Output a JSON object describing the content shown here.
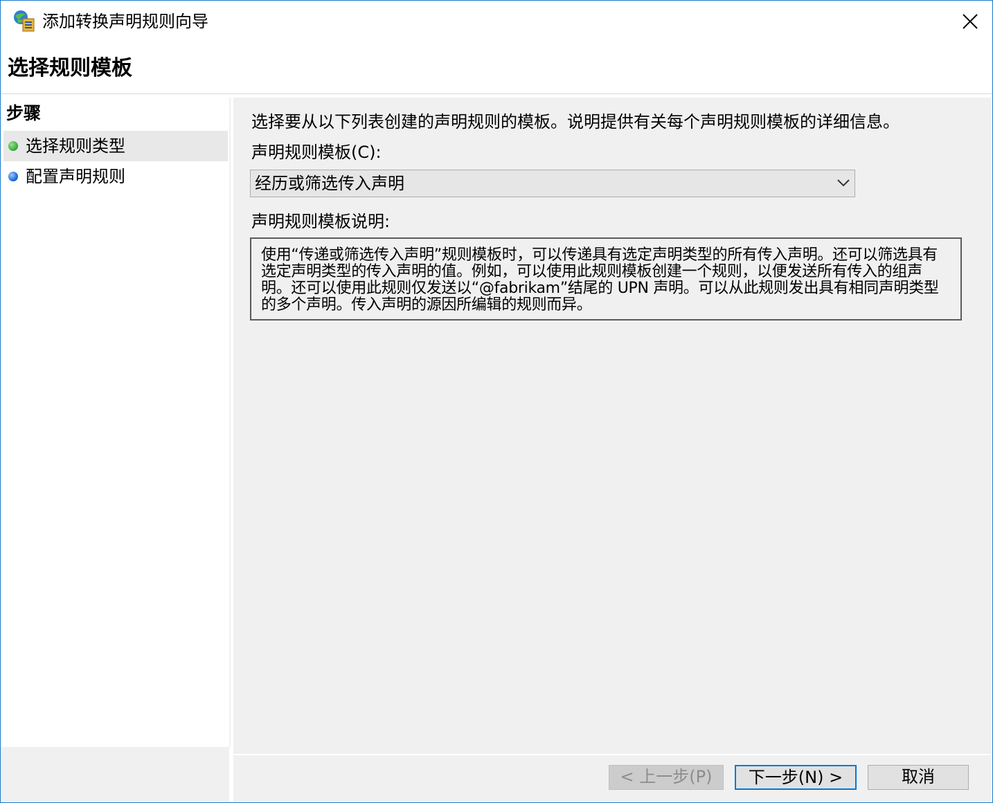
{
  "window": {
    "title": "添加转换声明规则向导",
    "icon": "wizard-app-icon",
    "close_icon": "close-icon"
  },
  "page": {
    "title": "选择规则模板"
  },
  "steps": {
    "heading": "步骤",
    "items": [
      {
        "label": "选择规则类型",
        "status": "current",
        "dot_color": "#3cb043"
      },
      {
        "label": "配置声明规则",
        "status": "pending",
        "dot_color": "#1e6fd9"
      }
    ]
  },
  "main": {
    "intro": "选择要从以下列表创建的声明规则的模板。说明提供有关每个声明规则模板的详细信息。",
    "template_label": "声明规则模板(C):",
    "template_selected": "经历或筛选传入声明",
    "description_label": "声明规则模板说明:",
    "description": "使用“传递或筛选传入声明”规则模板时，可以传递具有选定声明类型的所有传入声明。还可以筛选具有选定声明类型的传入声明的值。例如，可以使用此规则模板创建一个规则，以便发送所有传入的组声明。还可以使用此规则仅发送以“@fabrikam”结尾的 UPN 声明。可以从此规则发出具有相同声明类型的多个声明。传入声明的源因所编辑的规则而异。"
  },
  "buttons": {
    "back": "< 上一步(P)",
    "next": "下一步(N) >",
    "cancel": "取消"
  },
  "colors": {
    "window_border": "#1979ca",
    "accent": "#0078d7",
    "panel_bg": "#f0f0f0"
  }
}
